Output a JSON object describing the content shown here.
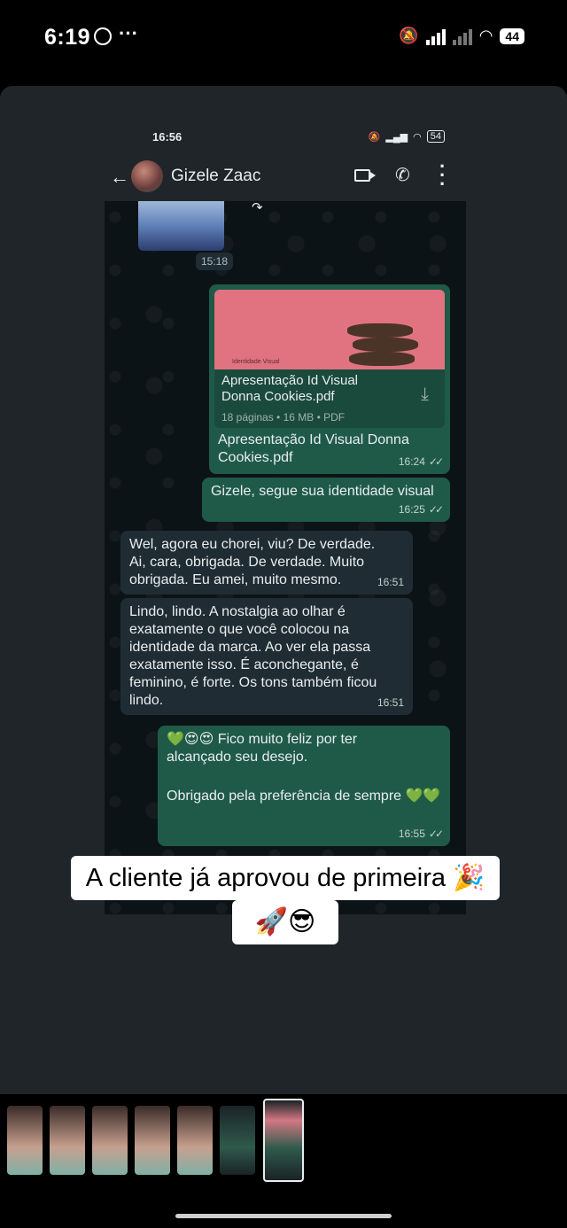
{
  "phone_status": {
    "time": "6:19",
    "battery": "44"
  },
  "inner_status": {
    "time": "16:56",
    "battery": "54"
  },
  "chat_header": {
    "contact_name": "Gizele Zaac"
  },
  "messages": {
    "image_time": "15:18",
    "doc_title": "Apresentação Id Visual Donna Cookies.pdf",
    "doc_meta": "18 páginas • 16 MB • PDF",
    "doc_preview_label": "Identidade Visual",
    "doc_caption": "Apresentação Id Visual Donna Cookies.pdf",
    "doc_time": "16:24",
    "msg2_text": "Gizele, segue sua identidade visual",
    "msg2_time": "16:25",
    "msg3_text": "Wel, agora eu chorei, viu? De verdade. Ai, cara, obrigada. De verdade. Muito obrigada. Eu amei, muito mesmo.",
    "msg3_time": "16:51",
    "msg4_text": "Lindo, lindo. A nostalgia ao olhar é exatamente o que você colocou na identidade da marca. Ao ver ela passa exatamente isso. É aconchegante, é feminino, é forte. Os tons também ficou lindo.",
    "msg4_time": "16:51",
    "msg5_line1": "💚😍😍 Fico muito feliz por ter alcançado seu desejo.",
    "msg5_line2": "Obrigado pela preferência de sempre 💚💚",
    "msg5_time": "16:55"
  },
  "overlay": {
    "caption_line1": "A cliente já aprovou de primeira 🎉",
    "caption_line2": "🚀😎"
  },
  "icons": [
    "whatsapp-icon",
    "back-arrow-icon",
    "video-call-icon",
    "phone-icon",
    "more-vert-icon",
    "download-icon",
    "forward-icon",
    "double-check-icon"
  ],
  "colors": {
    "outgoing_bubble": "#1f5a48",
    "incoming_bubble": "#1f2c33",
    "chat_bg": "#0c1317"
  }
}
